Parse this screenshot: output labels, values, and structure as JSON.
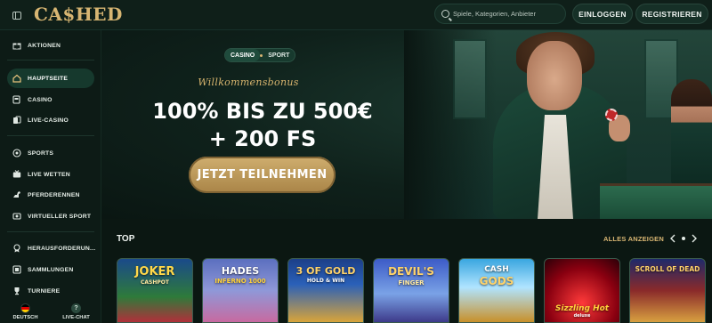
{
  "header": {
    "logo": "CA$HED",
    "search_placeholder": "Spiele, Kategorien, Anbieter",
    "login_label": "EINLOGGEN",
    "register_label": "REGISTRIEREN"
  },
  "sidebar": {
    "items": [
      {
        "label": "AKTIONEN",
        "icon": "gift-icon"
      },
      {
        "label": "HAUPTSEITE",
        "icon": "home-icon",
        "active": true
      },
      {
        "label": "CASINO",
        "icon": "slot-machine-icon"
      },
      {
        "label": "LIVE-CASINO",
        "icon": "cards-icon"
      },
      {
        "label": "SPORTS",
        "icon": "soccer-ball-icon"
      },
      {
        "label": "LIVE WETTEN",
        "icon": "live-tv-icon"
      },
      {
        "label": "PFERDERENNEN",
        "icon": "horse-icon"
      },
      {
        "label": "VIRTUELLER SPORT",
        "icon": "virtual-sport-icon"
      },
      {
        "label": "HERAUSFORDERUN...",
        "icon": "challenge-badge-icon"
      },
      {
        "label": "SAMMLUNGEN",
        "icon": "collection-icon"
      },
      {
        "label": "TURNIERE",
        "icon": "trophy-icon"
      }
    ],
    "language_label": "DEUTSCH",
    "chat_label": "LIVE-CHAT"
  },
  "hero": {
    "tab_casino": "CASINO",
    "tab_sport": "SPORT",
    "welcome": "Willkommensbonus",
    "headline_line1": "100% BIS ZU 500€",
    "headline_line2": "+ 200 FS",
    "cta_label": "JETZT TEILNEHMEN"
  },
  "top": {
    "title": "TOP",
    "show_all": "ALLES ANZEIGEN",
    "games": [
      {
        "title": "JOKER",
        "subtitle": "CASHPOT"
      },
      {
        "title": "HADES",
        "subtitle": "INFERNO 1000"
      },
      {
        "title": "3 OF GOLD",
        "subtitle": "HOLD & WIN"
      },
      {
        "title": "DEVIL'S",
        "subtitle": "FINGER"
      },
      {
        "title": "CASH",
        "subtitle": "GODS"
      },
      {
        "title": "Sizzling Hot",
        "subtitle": "deluxe"
      },
      {
        "title": "SCROLL OF DEAD",
        "subtitle": ""
      }
    ]
  },
  "colors": {
    "accent_gold": "#d7b572",
    "background": "#0b1712",
    "sidebar_active": "#16392d"
  }
}
